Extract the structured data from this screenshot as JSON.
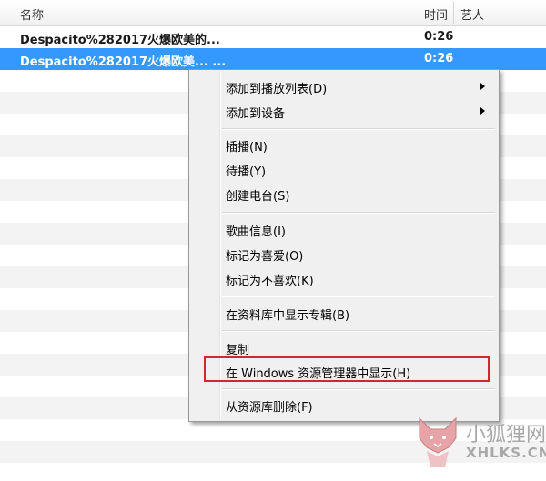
{
  "header": {
    "col_name": "名称",
    "col_time": "时间",
    "col_artist": "艺人"
  },
  "tracks": [
    {
      "name": "Despacito%282017火爆欧美的...",
      "time": "0:26"
    },
    {
      "name": "Despacito%282017火爆欧美... ...",
      "time": "0:26"
    }
  ],
  "context_menu": {
    "items": [
      {
        "label": "添加到播放列表(D)",
        "submenu": true
      },
      {
        "label": "添加到设备",
        "submenu": true
      },
      {
        "label": "插播(N)"
      },
      {
        "label": "待播(Y)"
      },
      {
        "label": "创建电台(S)"
      },
      {
        "label": "歌曲信息(I)"
      },
      {
        "label": "标记为喜爱(O)"
      },
      {
        "label": "标记为不喜欢(K)"
      },
      {
        "label": "在资料库中显示专辑(B)"
      },
      {
        "label": "复制"
      },
      {
        "label": "在 Windows 资源管理器中显示(H)"
      },
      {
        "label": "从资源库删除(F)"
      }
    ],
    "highlight_color": "#d9252a"
  },
  "watermark": {
    "title": "小狐狸网",
    "domain": "XHLKS.CN"
  },
  "colors": {
    "selection": "#3399ff"
  }
}
